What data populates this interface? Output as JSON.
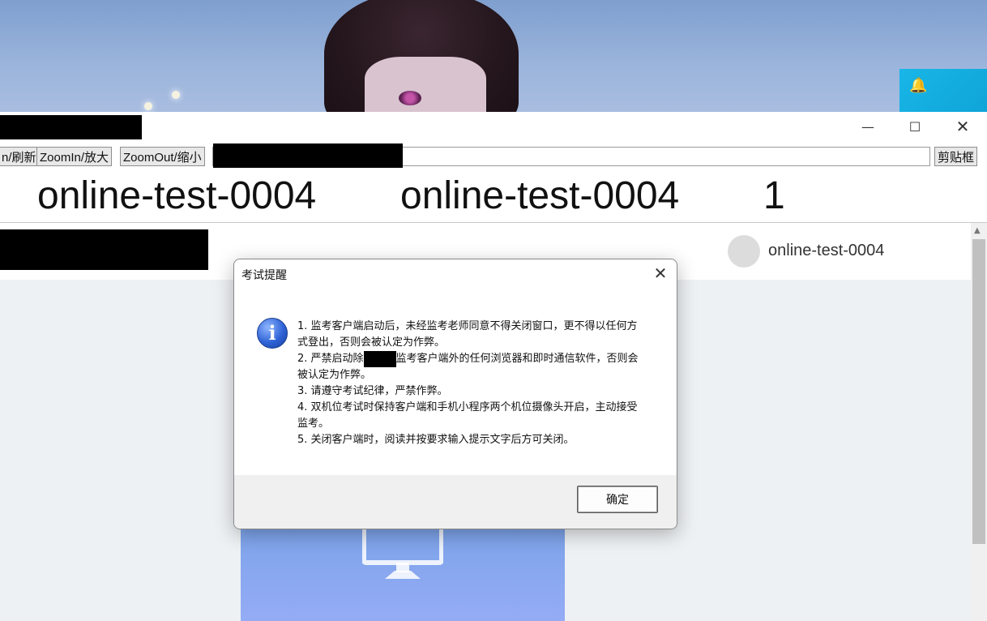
{
  "toolbar": {
    "refresh_label": "n/刷新",
    "zoom_in_label": "ZoomIn/放大",
    "zoom_out_label": "ZoomOut/缩小",
    "clipboard_label": "剪贴框"
  },
  "header": {
    "left_id": "online-test-0004",
    "middle_id": "online-test-0004",
    "number": "1"
  },
  "nav": {
    "username": "online-test-0004"
  },
  "dialog": {
    "title": "考试提醒",
    "line1": "1. 监考客户端启动后，未经监考老师同意不得关闭窗口，更不得以任何方式登出，否则会被认定为作弊。",
    "line2_pre": "2. 严禁启动除",
    "line2_post": "监考客户端外的任何浏览器和即时通信软件，否则会被认定为作弊。",
    "line3": "3. 请遵守考试纪律，严禁作弊。",
    "line4": "4. 双机位考试时保持客户端和手机小程序两个机位摄像头开启，主动接受监考。",
    "line5": "5. 关闭客户端时，阅读并按要求输入提示文字后方可关闭。",
    "ok_label": "确定"
  },
  "icons": {
    "minimize": "minimize-icon",
    "maximize": "maximize-icon",
    "close": "close-icon",
    "info": "info-icon",
    "monitor": "monitor-icon"
  },
  "colors": {
    "card_gradient_top": "#7aa2e8",
    "tray_app": "#19b6e8"
  }
}
